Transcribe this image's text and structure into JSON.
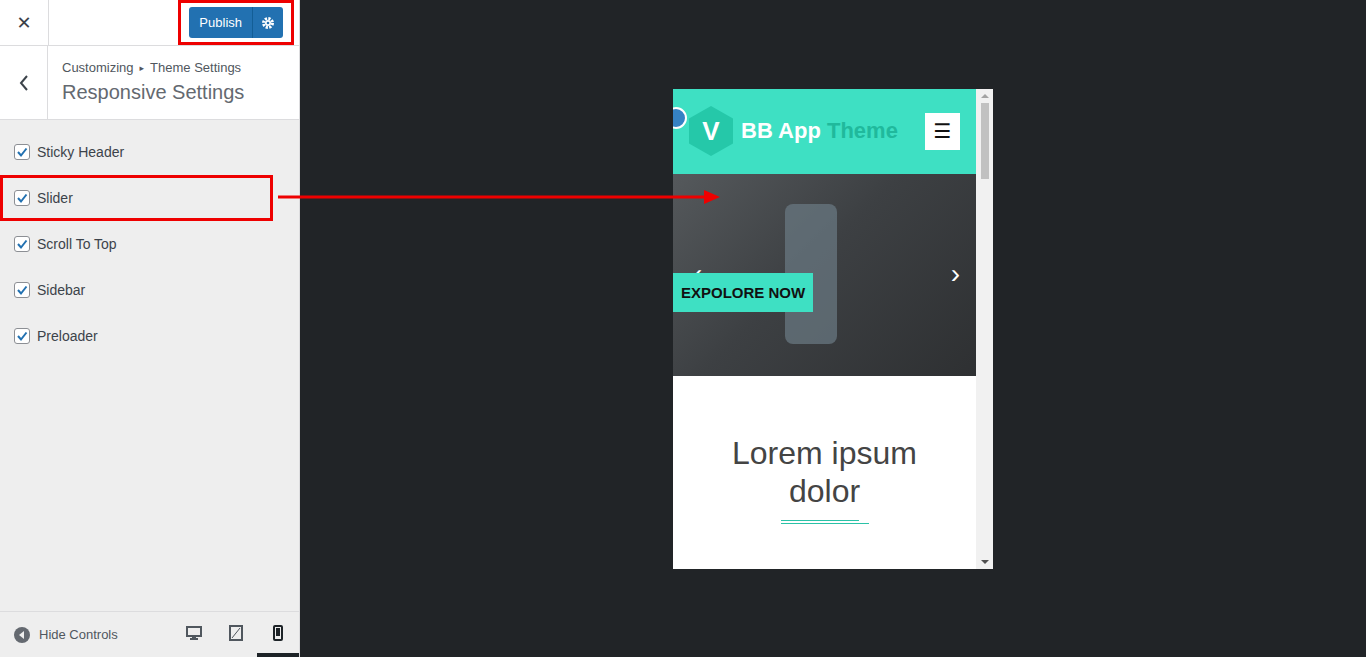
{
  "topbar": {
    "close": "✕",
    "publish": "Publish",
    "annotated": true
  },
  "breadcrumb": {
    "root": "Customizing",
    "separator": "▸",
    "section": "Theme Settings"
  },
  "title": "Responsive Settings",
  "settings": [
    {
      "label": "Sticky Header",
      "checked": true,
      "annotated": false
    },
    {
      "label": "Slider",
      "checked": true,
      "annotated": true
    },
    {
      "label": "Scroll To Top",
      "checked": true,
      "annotated": false
    },
    {
      "label": "Sidebar",
      "checked": true,
      "annotated": false
    },
    {
      "label": "Preloader",
      "checked": true,
      "annotated": false
    }
  ],
  "footer": {
    "hide_controls": "Hide Controls",
    "devices": [
      {
        "kind": "desktop",
        "selected": false
      },
      {
        "kind": "tablet",
        "selected": false
      },
      {
        "kind": "mobile",
        "selected": true
      }
    ]
  },
  "preview": {
    "logo_letter": "V",
    "site_name": "BB App",
    "site_name_accent": "Theme",
    "menu": "☰",
    "prev": "‹",
    "next": "›",
    "button": "EXPOLORE NOW",
    "heading": "Lorem ipsum dolor"
  }
}
